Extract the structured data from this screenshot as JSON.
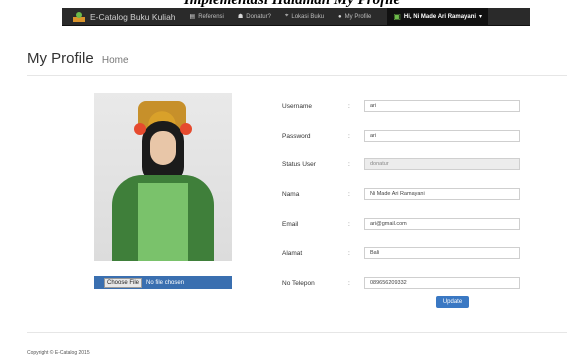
{
  "document": {
    "heading": "Implementasi Halaman My Profile"
  },
  "navbar": {
    "brand": "E-Catalog Buku Kuliah",
    "items": [
      {
        "icon": "book-icon",
        "label": "Referensi"
      },
      {
        "icon": "users-icon",
        "label": "Donatur?"
      },
      {
        "icon": "location-icon",
        "label": "Lokasi Buku"
      },
      {
        "icon": "user-icon",
        "label": "My Profile"
      }
    ],
    "user_greeting": "Hi, Ni Made Ari Ramayani"
  },
  "page": {
    "title": "My Profile",
    "subtitle": "Home"
  },
  "photo": {
    "caption": ""
  },
  "upload": {
    "button_label": "Choose File",
    "status": "No file chosen"
  },
  "form": {
    "fields": [
      {
        "label": "Username",
        "value": "ari",
        "disabled": false
      },
      {
        "label": "Password",
        "value": "ari",
        "disabled": false
      },
      {
        "label": "Status User",
        "value": "donatur",
        "disabled": true
      },
      {
        "label": "Nama",
        "value": "Ni Made Ari Ramayani",
        "disabled": false
      },
      {
        "label": "Email",
        "value": "ari@gmail.com",
        "disabled": false
      },
      {
        "label": "Alamat",
        "value": "Bali",
        "disabled": false
      },
      {
        "label": "No Telepon",
        "value": "089656209332",
        "disabled": false
      }
    ],
    "separator": ":",
    "submit_label": "Update"
  },
  "footer": {
    "copyright": "Copyright © E-Catalog 2015"
  },
  "colors": {
    "navbar_bg": "#2a2a2a",
    "accent_blue": "#3a78c3",
    "brand_green": "#6dbb4a"
  }
}
